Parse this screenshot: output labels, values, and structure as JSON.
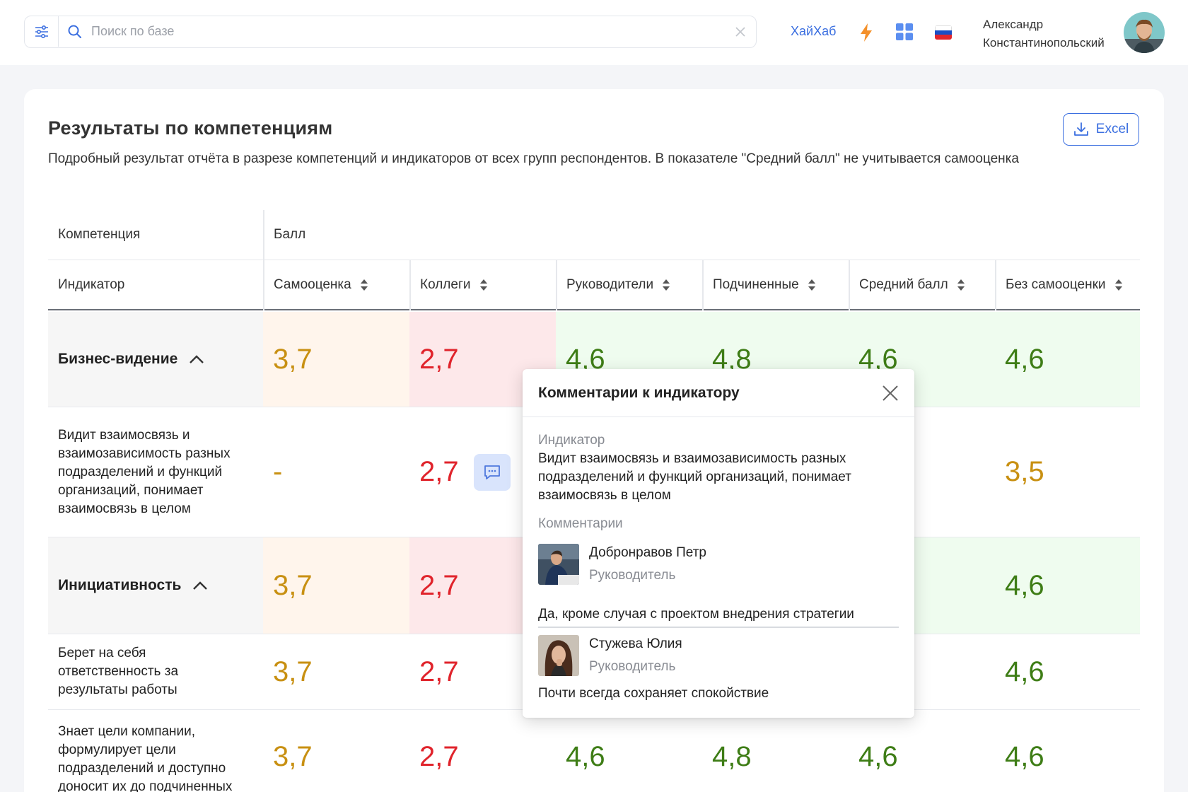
{
  "header": {
    "search_placeholder": "Поиск по базе",
    "brand_link": "ХайХаб",
    "user_name_line1": "Александр",
    "user_name_line2": "Константинопольский"
  },
  "card": {
    "title": "Результаты по компетенциям",
    "subtitle": "Подробный результат отчёта в разрезе компетенций и индикаторов от всех групп респондентов. В показателе \"Средний балл\" не учитывается самооценка",
    "excel_label": "Excel"
  },
  "table": {
    "head1": {
      "competency": "Компетенция",
      "score": "Балл"
    },
    "head2": {
      "indicator": "Индикатор",
      "columns": [
        "Самооценка",
        "Коллеги",
        "Руководители",
        "Подчиненные",
        "Средний балл",
        "Без самооценки"
      ]
    },
    "rows": [
      {
        "type": "competency",
        "label": "Бизнес-видение",
        "values": [
          "3,7",
          "2,7",
          "4,6",
          "4,8",
          "4,6",
          "4,6"
        ]
      },
      {
        "type": "indicator",
        "label": "Видит взаимосвязь и взаимозависимость разных подразделений и функций организаций, понимает взаимосвязь в целом",
        "values": [
          "-",
          "2,7",
          "",
          "",
          "",
          "3,5"
        ]
      },
      {
        "type": "competency",
        "label": "Инициативность",
        "values": [
          "3,7",
          "2,7",
          "",
          "",
          "",
          "4,6"
        ]
      },
      {
        "type": "indicator",
        "label": "Берет на себя ответственность за результаты работы",
        "values": [
          "3,7",
          "2,7",
          "",
          "",
          "",
          "4,6"
        ]
      },
      {
        "type": "indicator",
        "label": "Знает цели компании, формулирует цели подразделений и доступно доносит их до подчиненных",
        "values": [
          "3,7",
          "2,7",
          "4,6",
          "4,8",
          "4,6",
          "4,6"
        ]
      }
    ]
  },
  "popup": {
    "title": "Комментарии к индикатору",
    "indicator_label": "Индикатор",
    "indicator_text": "Видит взаимосвязь и взаимозависимость разных подразделений и функций организаций, понимает взаимосвязь в целом",
    "comments_label": "Комментарии",
    "comments": [
      {
        "name": "Добронравов Петр",
        "role": "Руководитель",
        "text": "Да,  кроме случая с проектом внедрения стратегии"
      },
      {
        "name": "Стужева Юлия",
        "role": "Руководитель",
        "text": "Почти всегда сохраняет спокойствие"
      }
    ]
  },
  "colors": {
    "accent": "#3b6fe0",
    "score_yellow": "#c89012",
    "score_red": "#e0242c",
    "score_green": "#3e7d16"
  },
  "icons": [
    "filter-icon",
    "search-icon",
    "clear-icon",
    "bolt-icon",
    "apps-grid-icon",
    "russia-flag-icon",
    "download-icon",
    "sort-icon",
    "chevron-up-icon",
    "comment-icon",
    "close-icon"
  ]
}
